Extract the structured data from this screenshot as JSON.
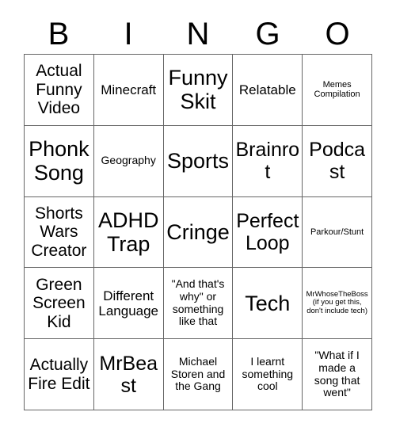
{
  "card": {
    "header_letters": [
      "B",
      "I",
      "N",
      "G",
      "O"
    ],
    "columns": 5,
    "rows": 5,
    "border_color": "#666666",
    "text_color": "#000000",
    "background_color": "#ffffff",
    "cells": [
      {
        "text": "Actual Funny Video",
        "size": "lg"
      },
      {
        "text": "Minecraft",
        "size": "md"
      },
      {
        "text": "Funny Skit",
        "size": "xxl"
      },
      {
        "text": "Relatable",
        "size": "md"
      },
      {
        "text": "Memes Compilation",
        "size": "xs"
      },
      {
        "text": "Phonk Song",
        "size": "xxl"
      },
      {
        "text": "Geography",
        "size": "sm"
      },
      {
        "text": "Sports",
        "size": "xxl"
      },
      {
        "text": "Brainrot",
        "size": "xl"
      },
      {
        "text": "Podcast",
        "size": "xl"
      },
      {
        "text": "Shorts Wars Creator",
        "size": "lg"
      },
      {
        "text": "ADHD Trap",
        "size": "xxl"
      },
      {
        "text": "Cringe",
        "size": "xxl"
      },
      {
        "text": "Perfect Loop",
        "size": "xl"
      },
      {
        "text": "Parkour/Stunt",
        "size": "xs"
      },
      {
        "text": "Green Screen Kid",
        "size": "lg"
      },
      {
        "text": "Different Language",
        "size": "md"
      },
      {
        "text": "\"And that's why\" or something like that",
        "size": "sm"
      },
      {
        "text": "Tech",
        "size": "xxl"
      },
      {
        "text": "MrWhoseTheBoss (if you get this, don't include tech)",
        "size": "xxs"
      },
      {
        "text": "Actually Fire Edit",
        "size": "lg"
      },
      {
        "text": "MrBeast",
        "size": "xl"
      },
      {
        "text": "Michael Storen and the Gang",
        "size": "sm"
      },
      {
        "text": "I learnt something cool",
        "size": "sm"
      },
      {
        "text": "\"What if I made a song that went\"",
        "size": "sm"
      }
    ]
  }
}
